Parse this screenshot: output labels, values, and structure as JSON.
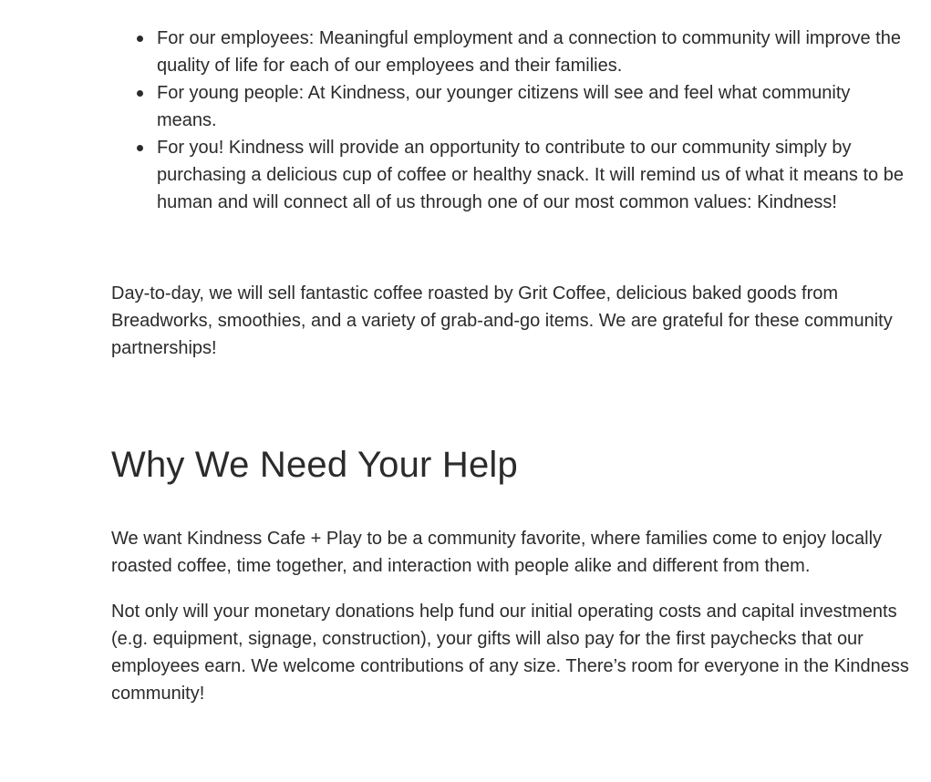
{
  "bullets": [
    "For our employees: Meaningful employment and a connection to community will improve the quality of life for each of our employees and their families.",
    "For young people: At Kindness, our younger citizens will see and feel what community means.",
    "For you! Kindness will provide an opportunity to contribute to our community simply by purchasing a delicious cup of coffee or healthy snack. It will remind us of what it means to be human and will connect all of us through one of our most common values: Kindness!"
  ],
  "paragraph_day_to_day": "Day-to-day, we will sell fantastic coffee roasted by Grit Coffee, delicious baked goods from Breadworks, smoothies, and a variety of grab-and-go items. We are grateful for these community partnerships!",
  "section": {
    "heading": "Why We Need Your Help",
    "paragraphs": [
      "We want Kindness Cafe + Play to be a community favorite, where families come to enjoy locally roasted coffee, time together, and interaction with people alike and different from them.",
      "Not only will your monetary donations help fund our initial operating costs and capital investments (e.g. equipment, signage, construction), your gifts will also pay for the first paychecks that our employees earn. We welcome contributions of any size. There’s room for everyone in the Kindness community!"
    ]
  }
}
